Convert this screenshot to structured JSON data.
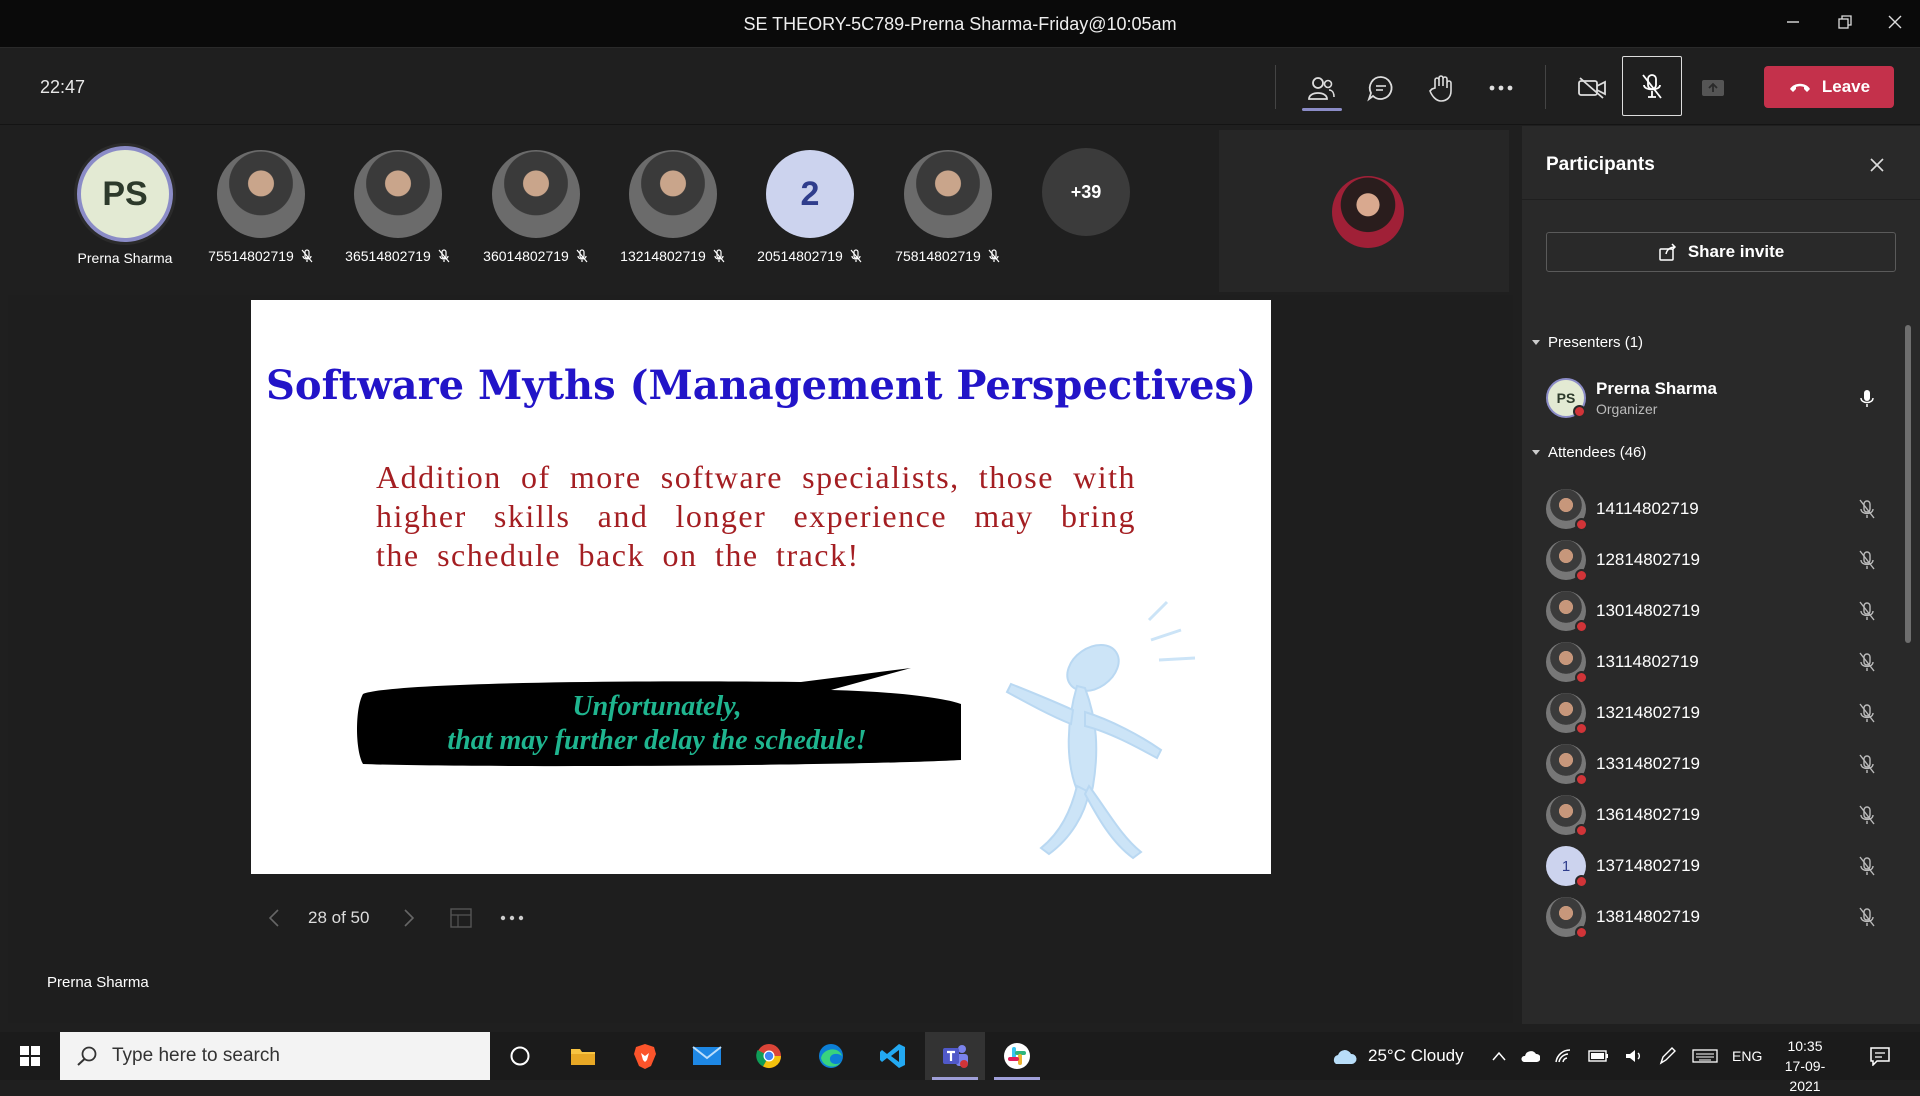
{
  "window": {
    "title": "SE THEORY-5C789-Prerna Sharma-Friday@10:05am"
  },
  "toolbar": {
    "timer": "22:47",
    "leave_label": "Leave"
  },
  "strip": {
    "presenter": {
      "initials": "PS",
      "name": "Prerna Sharma"
    },
    "participants": [
      {
        "name": "75514802719",
        "avatar": "photo"
      },
      {
        "name": "36514802719",
        "avatar": "photo"
      },
      {
        "name": "36014802719",
        "avatar": "photo"
      },
      {
        "name": "13214802719",
        "avatar": "photo"
      },
      {
        "name": "20514802719",
        "avatar": "2"
      },
      {
        "name": "75814802719",
        "avatar": "photo"
      }
    ],
    "overflow": "+39"
  },
  "slide": {
    "title": "Software Myths (Management Perspectives)",
    "body": "Addition of more software specialists, those with higher skills and longer experience may bring the schedule back on the track!",
    "bubble_line1": "Unfortunately,",
    "bubble_line2": "that may further delay the schedule!"
  },
  "slide_nav": {
    "counter": "28 of 50"
  },
  "presenter_label": "Prerna Sharma",
  "panel": {
    "title": "Participants",
    "share_label": "Share invite",
    "presenters_heading": "Presenters (1)",
    "presenter": {
      "initials": "PS",
      "name": "Prerna Sharma",
      "role": "Organizer"
    },
    "attendees_heading": "Attendees (46)",
    "attendees": [
      {
        "name": "14114802719",
        "avatar": "photo"
      },
      {
        "name": "12814802719",
        "avatar": "photo"
      },
      {
        "name": "13014802719",
        "avatar": "photo"
      },
      {
        "name": "13114802719",
        "avatar": "photo"
      },
      {
        "name": "13214802719",
        "avatar": "photo"
      },
      {
        "name": "13314802719",
        "avatar": "photo"
      },
      {
        "name": "13614802719",
        "avatar": "photo"
      },
      {
        "name": "13714802719",
        "avatar": "1"
      },
      {
        "name": "13814802719",
        "avatar": "photo"
      }
    ]
  },
  "taskbar": {
    "search_placeholder": "Type here to search",
    "weather": "25°C  Cloudy",
    "language": "ENG",
    "time": "10:35",
    "date": "17-09-2021"
  },
  "colors": {
    "accent": "#8b8cc7",
    "leave": "#c4314b",
    "slide_title": "#2214c8",
    "slide_body": "#a41e22",
    "bubble_text": "#1fb58f"
  }
}
